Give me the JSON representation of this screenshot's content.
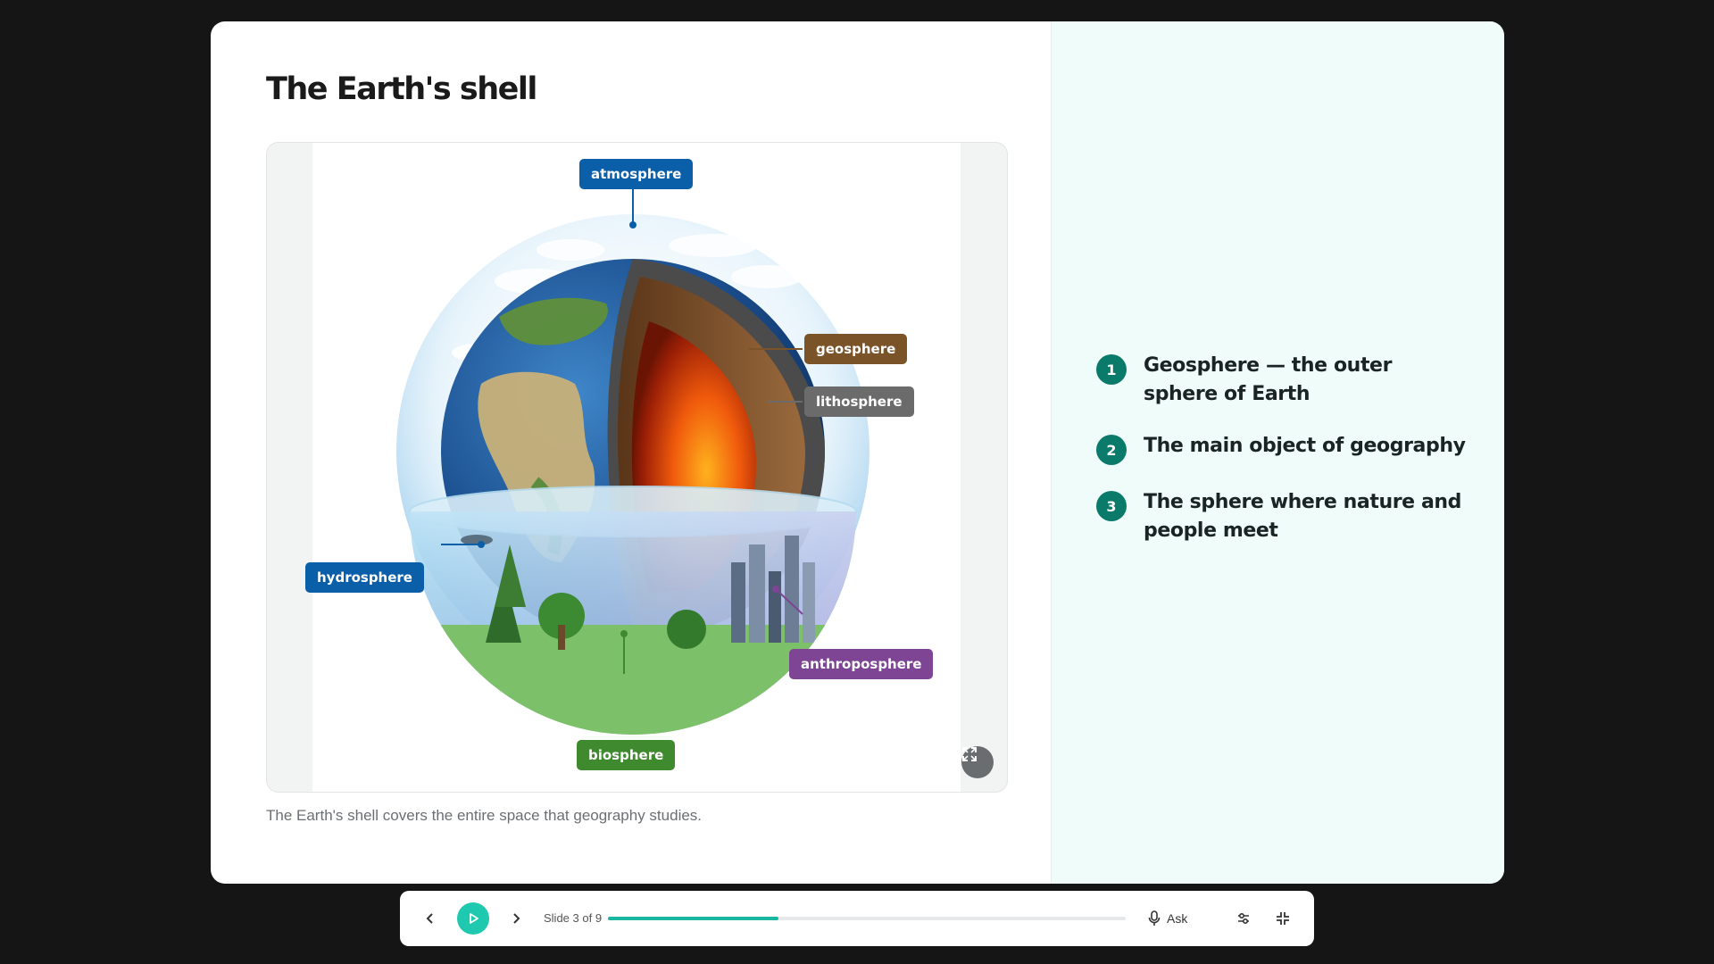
{
  "slide": {
    "title": "The Earth's shell",
    "caption": "The Earth's shell covers the entire space that geography studies.",
    "figure": {
      "labels": {
        "atmosphere": "atmosphere",
        "geosphere": "geosphere",
        "lithosphere": "lithosphere",
        "hydrosphere": "hydrosphere",
        "anthroposphere": "anthroposphere",
        "biosphere": "biosphere"
      },
      "colors": {
        "atmosphere": "#0b5fa8",
        "geosphere": "#7b5329",
        "lithosphere": "#6b6b6b",
        "hydrosphere": "#0b5fa8",
        "anthroposphere": "#7d4593",
        "biosphere": "#3f8a2e"
      }
    },
    "points": [
      {
        "number": "1",
        "text": "Geosphere — the outer sphere of Earth"
      },
      {
        "number": "2",
        "text": "The main object of geography"
      },
      {
        "number": "3",
        "text": "The sphere where nature and people meet"
      }
    ]
  },
  "controls": {
    "slide_indicator": "Slide 3 of 9",
    "progress": 0.33,
    "ask_label": "Ask",
    "accent": "#1ec9b0"
  }
}
